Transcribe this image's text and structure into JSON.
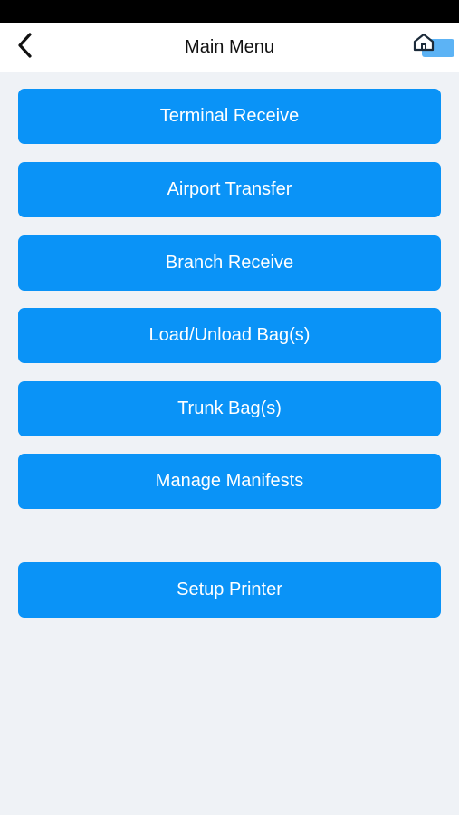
{
  "nav": {
    "title": "Main Menu",
    "back_icon": "chevron-left-icon",
    "home_icon": "home-icon"
  },
  "menu": {
    "terminal_receive": "Terminal Receive",
    "airport_transfer": "Airport Transfer",
    "branch_receive": "Branch Receive",
    "load_unload_bags": "Load/Unload Bag(s)",
    "trunk_bags": "Trunk Bag(s)",
    "manage_manifests": "Manage Manifests",
    "setup_printer": "Setup Printer"
  },
  "colors": {
    "accent": "#0a93f7",
    "background": "#eff2f6",
    "nav_background": "#ffffff"
  }
}
